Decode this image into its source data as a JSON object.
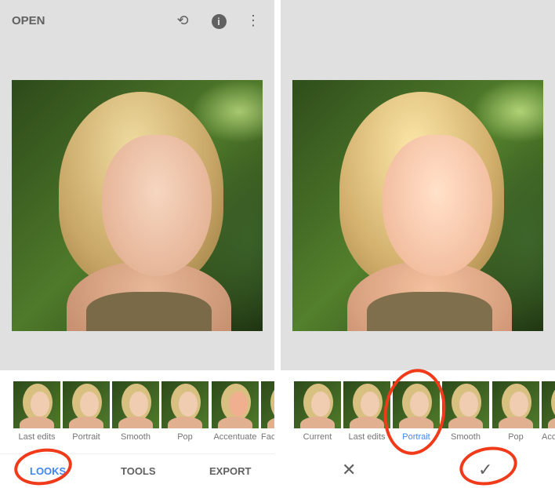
{
  "left": {
    "toolbar": {
      "open_label": "OPEN",
      "icons": [
        "layers-undo-icon",
        "info-icon",
        "more-vert-icon"
      ]
    },
    "looks": [
      "Last edits",
      "Portrait",
      "Smooth",
      "Pop",
      "Accentuate",
      "Faces"
    ],
    "tabs": {
      "looks": "LOOKS",
      "tools": "TOOLS",
      "export": "EXPORT"
    },
    "active_tab": "LOOKS"
  },
  "right": {
    "looks": [
      "Current",
      "Last edits",
      "Portrait",
      "Smooth",
      "Pop",
      "Accentuate"
    ],
    "selected": "Portrait",
    "actions": {
      "cancel": "✕",
      "apply": "✓"
    }
  },
  "colors": {
    "accent": "#4285f4",
    "annotation": "#f03a1a",
    "canvas": "#e0e0e0"
  }
}
